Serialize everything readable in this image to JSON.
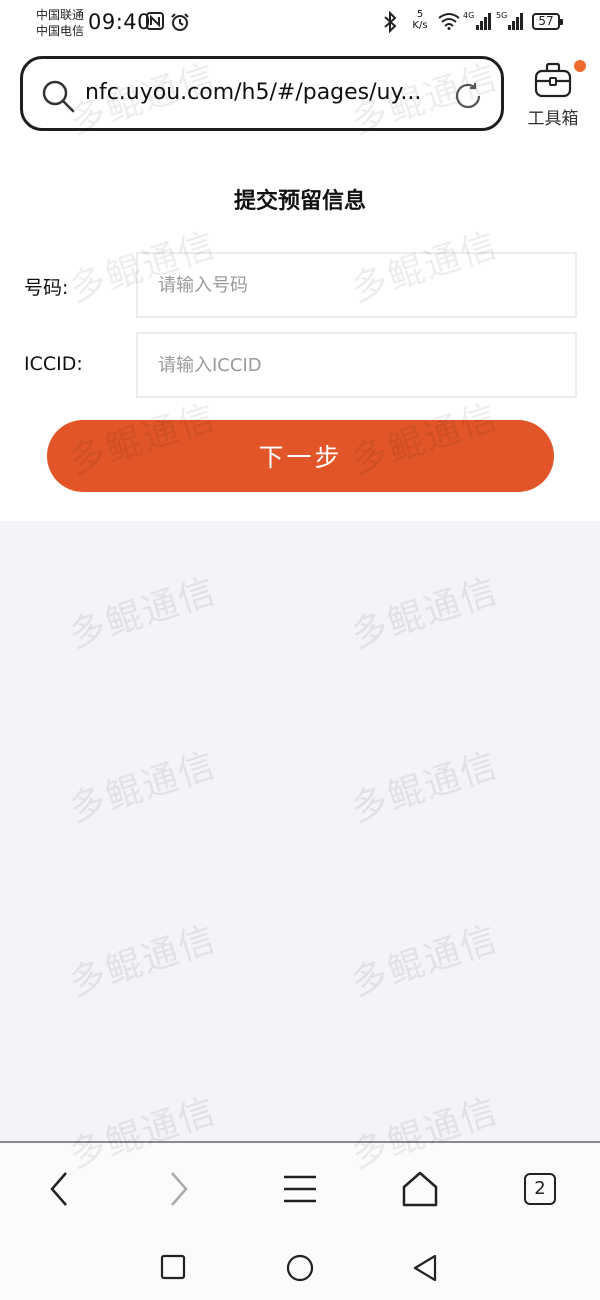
{
  "status_bar": {
    "carrier_1": "中国联通",
    "carrier_2": "中国电信",
    "time": "09:40",
    "speed_value": "5",
    "speed_unit": "K/s",
    "network_1": "4G",
    "network_2": "5G",
    "battery": "57"
  },
  "browser": {
    "url": "nfc.uyou.com/h5/#/pages/uy...",
    "toolbox_label": "工具箱"
  },
  "form": {
    "title": "提交预留信息",
    "phone_label": "号码:",
    "phone_placeholder": "请输入号码",
    "phone_value": "",
    "iccid_label": "ICCID:",
    "iccid_placeholder": "请输入ICCID",
    "iccid_value": "",
    "next_button": "下一步"
  },
  "bottom_nav": {
    "tab_count": "2"
  },
  "watermark": "多鲲通信",
  "colors": {
    "accent": "#e15528",
    "badge": "#ef6a2f",
    "background_grey": "#f4f3f8"
  }
}
